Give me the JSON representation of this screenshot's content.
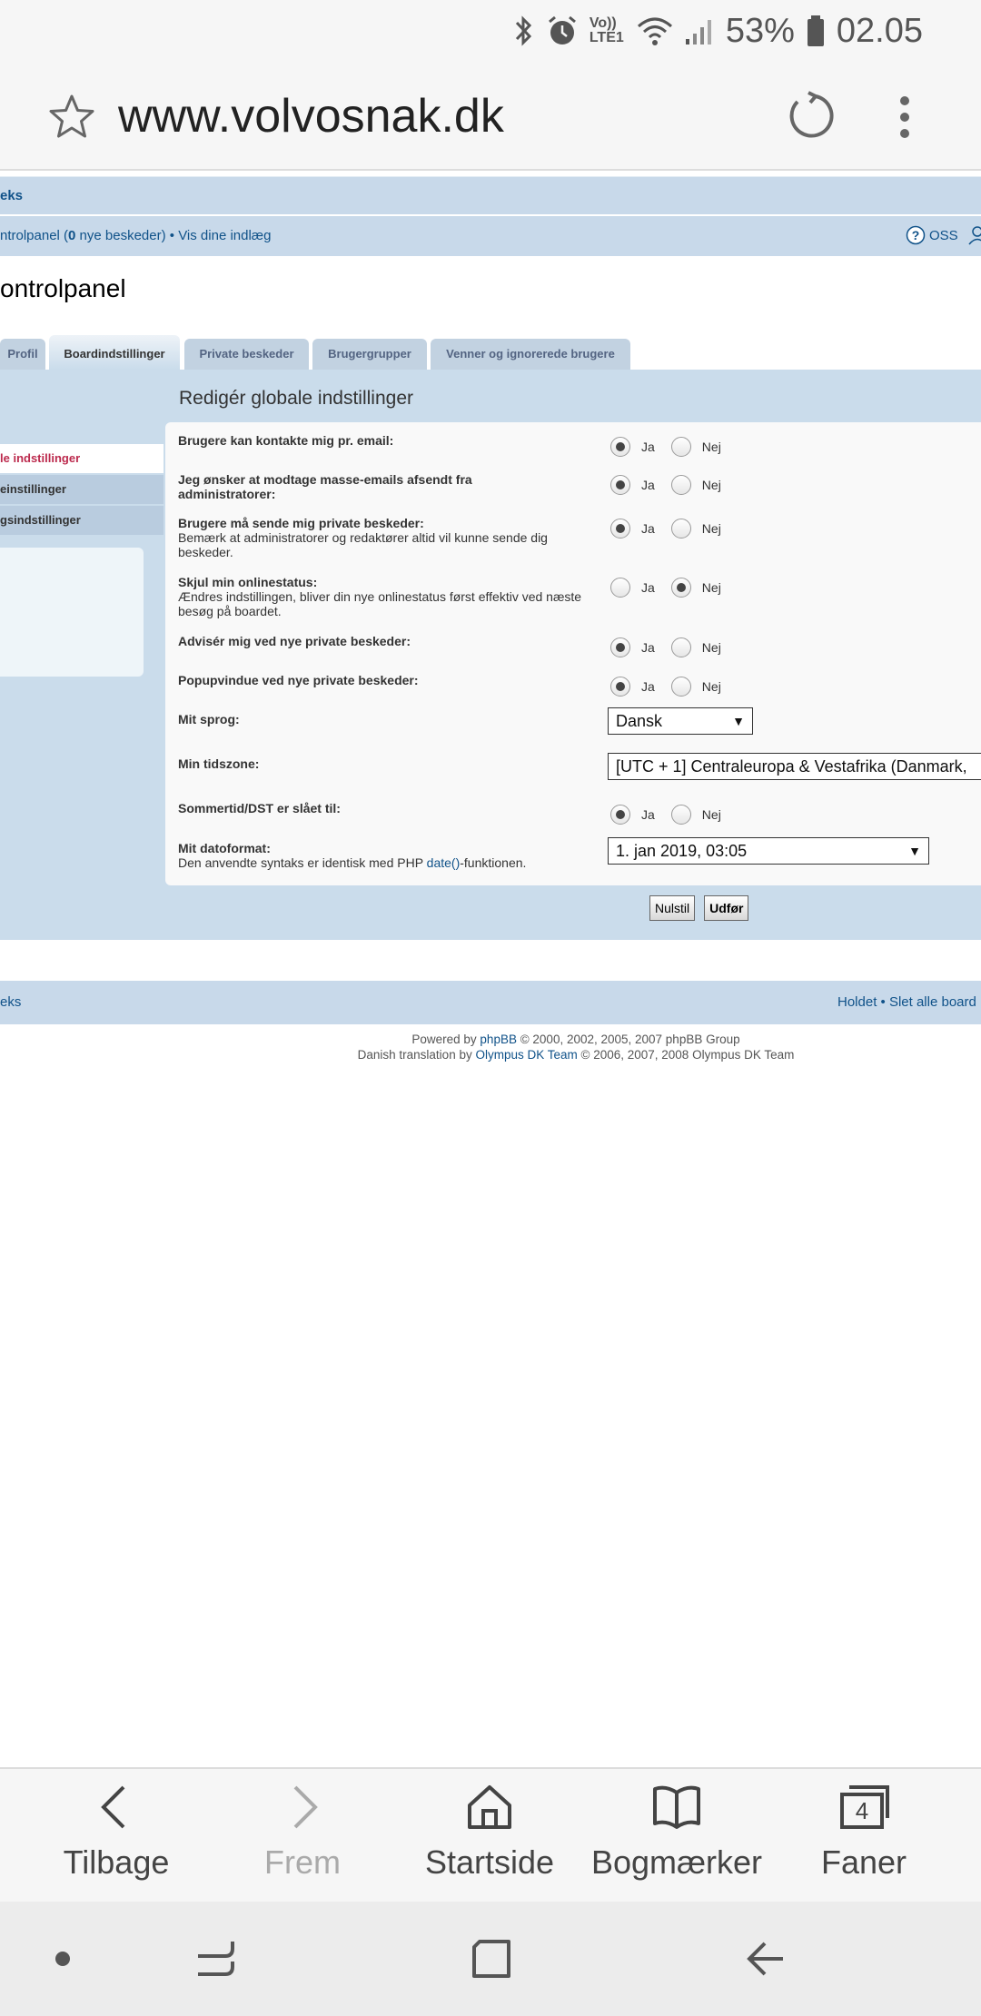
{
  "status": {
    "volte": "Vo)) LTE1",
    "battery": "53%",
    "time": "02.05"
  },
  "browser": {
    "url": "www.volvosnak.dk"
  },
  "forum": {
    "nav_link": "eks",
    "controlpanel_prefix": "ntrolpanel (",
    "new_count": "0",
    "controlpanel_suffix": " nye beskeder) • Vis dine indlæg",
    "faq": "OSS",
    "page_title": "ontrolpanel",
    "tabs": [
      "Profil",
      "Boardindstillinger",
      "Private beskeder",
      "Brugergrupper",
      "Venner og ignorerede brugere"
    ],
    "side_nav": [
      "le indstillinger",
      "einstillinger",
      "gsindstillinger"
    ],
    "section_title": "Redigér globale indstillinger",
    "yes": "Ja",
    "no": "Nej",
    "rows": [
      {
        "label": "Brugere kan kontakte mig pr. email:",
        "note": ""
      },
      {
        "label": "Jeg ønsker at modtage masse-emails afsendt fra administratorer:",
        "note": ""
      },
      {
        "label": "Brugere må sende mig private beskeder:",
        "note": "Bemærk at administratorer og redaktører altid vil kunne sende dig beskeder."
      },
      {
        "label": "Skjul min onlinestatus:",
        "note": "Ændres indstillingen, bliver din nye onlinestatus først effektiv ved næste besøg på boardet."
      },
      {
        "label": "Advisér mig ved nye private beskeder:",
        "note": ""
      },
      {
        "label": "Popupvindue ved nye private beskeder:",
        "note": ""
      },
      {
        "label": "Mit sprog:",
        "note": ""
      },
      {
        "label": "Min tidszone:",
        "note": ""
      },
      {
        "label": "Sommertid/DST er slået til:",
        "note": ""
      },
      {
        "label": "Mit datoformat:",
        "note_prefix": "Den anvendte syntaks er identisk med PHP ",
        "note_link": "date()",
        "note_suffix": "-funktionen."
      }
    ],
    "language_value": "Dansk",
    "timezone_value": "[UTC + 1] Centraleuropa & Vestafrika (Danmark,",
    "dateformat_value": "1. jan 2019, 03:05",
    "reset_button": "Nulstil",
    "submit_button": "Udfør",
    "footer_left": "eks",
    "footer_right": "Holdet • Slet alle board",
    "powered_prefix": "Powered by ",
    "powered_link": "phpBB",
    "powered_suffix": " © 2000, 2002, 2005, 2007 phpBB Group",
    "translation_prefix": "Danish translation by ",
    "translation_link": "Olympus DK Team",
    "translation_suffix": " © 2006, 2007, 2008 Olympus DK Team"
  },
  "toolbar": {
    "back": "Tilbage",
    "forward": "Frem",
    "home": "Startside",
    "bookmarks": "Bogmærker",
    "tabs": "Faner",
    "tab_count": "4"
  }
}
